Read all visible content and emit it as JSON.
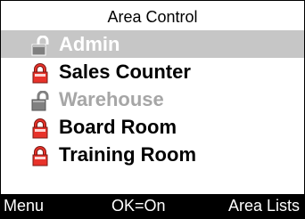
{
  "screen": {
    "title": "Area Control"
  },
  "areas": [
    {
      "label": "Admin",
      "lock": "unlocked-lock-icon",
      "selected": true,
      "disabled": false
    },
    {
      "label": "Sales Counter",
      "lock": "locked-lock-icon",
      "selected": false,
      "disabled": false
    },
    {
      "label": "Warehouse",
      "lock": "unlocked-lock-icon",
      "selected": false,
      "disabled": true
    },
    {
      "label": "Board Room",
      "lock": "locked-lock-icon",
      "selected": false,
      "disabled": false
    },
    {
      "label": "Training Room",
      "lock": "locked-lock-icon",
      "selected": false,
      "disabled": false
    }
  ],
  "softkeys": {
    "left": "Menu",
    "center": "OK=On",
    "right": "Area Lists"
  },
  "colors": {
    "selected_row": "#c6c6c6",
    "selected_text": "#ffffff",
    "disabled_text": "#a6a6a6",
    "lock_red": "#e8322a",
    "lock_grey": "#808080",
    "softkey_bar": "#000000"
  }
}
